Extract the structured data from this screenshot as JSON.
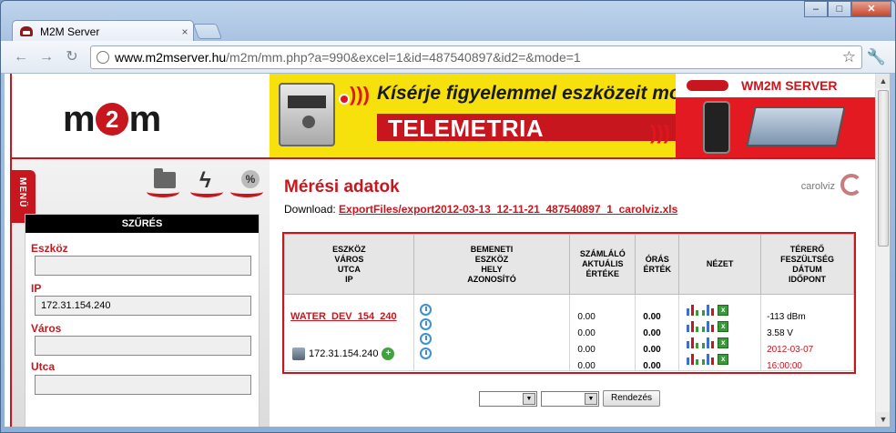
{
  "browser": {
    "tab_title": "M2M Server",
    "tab_close": "×",
    "url_host": "www.m2mserver.hu",
    "url_path": "/m2m/mm.php?a=990&excel=1&id=487540897&id2=&mode=1",
    "window_buttons": {
      "minimize": "–",
      "maximize": "□",
      "close": "✕"
    },
    "back": "←",
    "forward": "→",
    "reload": "↻",
    "star": "☆",
    "wrench": "🔧"
  },
  "header": {
    "logo_left": "m",
    "logo_mid": "2",
    "logo_right": "m",
    "banner_headline": "Kísérje figyelemmel eszközeit mobilon!",
    "banner_product": "TELEMETRIA",
    "banner_brand": "WM2M SERVER"
  },
  "sidebar": {
    "menu_label": "MENÜ",
    "icons": [
      "folder-icon",
      "power-icon",
      "percent-icon"
    ],
    "filter_title": "SZŰRÉS",
    "fields": [
      {
        "label": "Eszköz",
        "value": ""
      },
      {
        "label": "IP",
        "value": "172.31.154.240"
      },
      {
        "label": "Város",
        "value": ""
      },
      {
        "label": "Utca",
        "value": ""
      }
    ]
  },
  "main": {
    "title": "Mérési adatok",
    "user": "carolviz",
    "download_label": "Download:",
    "download_link": "ExportFiles/export2012-03-13_12-11-21_487540897_1_carolviz.xls",
    "table": {
      "headers": [
        [
          "ESZKÖZ",
          "VÁROS",
          "UTCA",
          "IP"
        ],
        [
          "BEMENETI",
          "ESZKÖZ",
          "HELY",
          "AZONOSÍTÓ"
        ],
        [
          "SZÁMLÁLÓ",
          "AKTUÁLIS",
          "ÉRTÉKE"
        ],
        [
          "ÓRÁS",
          "ÉRTÉK"
        ],
        [
          "NÉZET"
        ],
        [
          "TÉRERŐ",
          "FESZÜLTSÉG",
          "DÁTUM",
          "IDŐPONT"
        ]
      ],
      "row": {
        "device": "WATER_DEV_154_240",
        "ip": "172.31.154.240",
        "counter_values": [
          "0.00",
          "0.00",
          "0.00",
          "0.00"
        ],
        "hourly_values": [
          "0.00",
          "0.00",
          "0.00",
          "0.00"
        ],
        "signal": "-113 dBm",
        "voltage": "3.58 V",
        "date": "2012-03-07",
        "time": "16:00:00"
      }
    },
    "sort_button": "Rendezés"
  },
  "colors": {
    "accent": "#c8161e",
    "banner_yellow": "#f6e10c"
  }
}
